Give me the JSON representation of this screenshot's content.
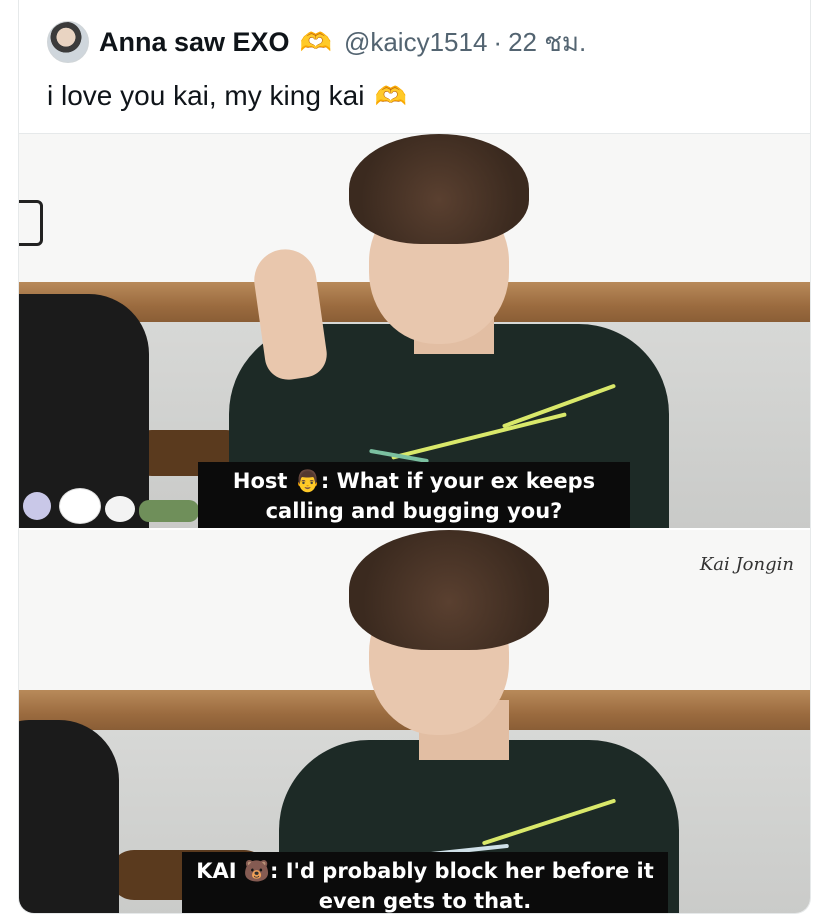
{
  "tweet": {
    "display_name": "Anna saw EXO",
    "name_emoji": "🫶",
    "handle": "@kaicy1514",
    "separator": "·",
    "time": "22 ชม.",
    "text": "i love you kai, my king kai",
    "text_emoji": "🫶"
  },
  "media": {
    "subtitle_top": "Host 👨: What if your ex keeps calling and bugging you?",
    "subtitle_bottom": "KAI 🐻: I'd probably block her before it even gets to that.",
    "watermark": "Kai Jongin"
  }
}
